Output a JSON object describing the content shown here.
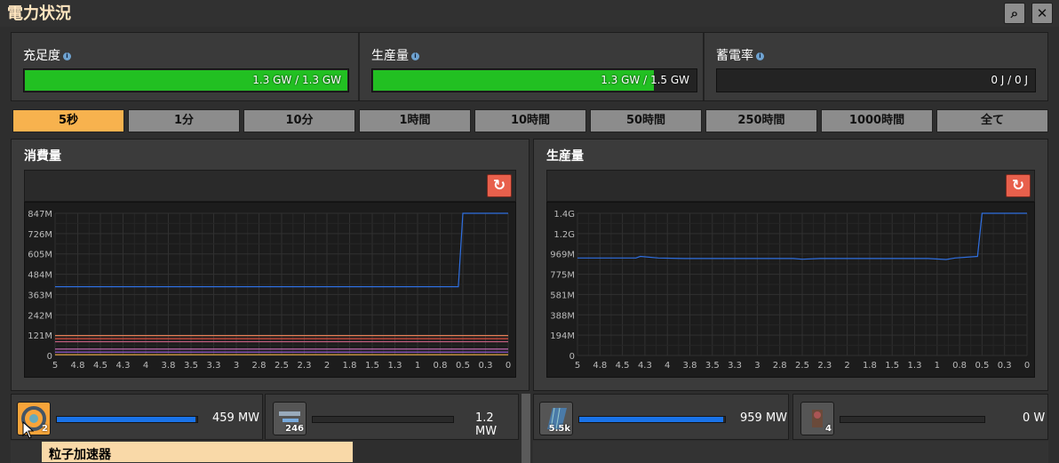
{
  "window": {
    "title": "電力状況"
  },
  "stats": [
    {
      "label": "充足度",
      "value": "1.3 GW / 1.3 GW",
      "fill": 1.0
    },
    {
      "label": "生産量",
      "value": "1.3 GW / 1.5 GW",
      "fill": 0.87
    },
    {
      "label": "蓄電率",
      "value": "0 J / 0 J",
      "fill": 0.0
    }
  ],
  "tabs": [
    "5秒",
    "1分",
    "10分",
    "1時間",
    "10時間",
    "50時間",
    "250時間",
    "1000時間",
    "全て"
  ],
  "active_tab": 0,
  "panels": {
    "consumption": {
      "title": "消費量"
    },
    "production": {
      "title": "生産量"
    }
  },
  "chart_data": [
    {
      "type": "line",
      "title": "消費量",
      "x_ticks": [
        "5",
        "4.8",
        "4.5",
        "4.3",
        "4",
        "3.8",
        "3.5",
        "3.3",
        "3",
        "2.8",
        "2.5",
        "2.3",
        "2",
        "1.8",
        "1.5",
        "1.3",
        "1",
        "0.8",
        "0.5",
        "0.3",
        "0"
      ],
      "y_ticks": [
        "0",
        "121M",
        "242M",
        "363M",
        "484M",
        "605M",
        "726M",
        "847M"
      ],
      "ylim": [
        0,
        847
      ],
      "xlim": [
        5,
        0
      ],
      "series": [
        {
          "color": "#2f6fe0",
          "x": [
            5,
            0.55,
            0.5,
            0
          ],
          "y": [
            410,
            410,
            847,
            847
          ]
        },
        {
          "color": "#ff8a5c",
          "x": [
            5,
            0
          ],
          "y": [
            118,
            118
          ]
        },
        {
          "color": "#e05040",
          "x": [
            5,
            0
          ],
          "y": [
            100,
            100
          ]
        },
        {
          "color": "#c06080",
          "x": [
            5,
            0
          ],
          "y": [
            82,
            82
          ]
        },
        {
          "color": "#d070c0",
          "x": [
            5,
            0
          ],
          "y": [
            38,
            38
          ]
        },
        {
          "color": "#a060e0",
          "x": [
            5,
            0
          ],
          "y": [
            20,
            20
          ]
        },
        {
          "color": "#e0a040",
          "x": [
            5,
            0
          ],
          "y": [
            5,
            5
          ]
        }
      ]
    },
    {
      "type": "line",
      "title": "生産量",
      "x_ticks": [
        "5",
        "4.8",
        "4.5",
        "4.3",
        "4",
        "3.8",
        "3.5",
        "3.3",
        "3",
        "2.8",
        "2.5",
        "2.3",
        "2",
        "1.8",
        "1.5",
        "1.3",
        "1",
        "0.8",
        "0.5",
        "0.3",
        "0"
      ],
      "y_ticks": [
        "0",
        "194M",
        "388M",
        "581M",
        "775M",
        "969M",
        "1.2G",
        "1.4G"
      ],
      "ylim": [
        0,
        1356
      ],
      "xlim": [
        5,
        0
      ],
      "series": [
        {
          "color": "#2f6fe0",
          "x": [
            5,
            4.35,
            4.3,
            4.1,
            3.8,
            2.6,
            2.5,
            2.3,
            1.1,
            0.9,
            0.8,
            0.55,
            0.5,
            0
          ],
          "y": [
            930,
            930,
            945,
            930,
            925,
            925,
            918,
            925,
            925,
            915,
            930,
            945,
            1356,
            1356
          ]
        }
      ]
    }
  ],
  "consumers": [
    {
      "icon": "particle-accelerator-icon",
      "count": "2",
      "value": "459 MW",
      "fill": 1.0
    },
    {
      "icon": "assembler-icon",
      "count": "246",
      "value": "1.2 MW",
      "fill": 0.0
    }
  ],
  "producers": [
    {
      "icon": "solar-panel-icon",
      "count": "5.5k",
      "value": "959 MW",
      "fill": 1.0
    },
    {
      "icon": "steam-engine-icon",
      "count": "4",
      "value": "0 W",
      "fill": 0.0
    }
  ],
  "tooltip": {
    "text": "粒子加速器"
  }
}
